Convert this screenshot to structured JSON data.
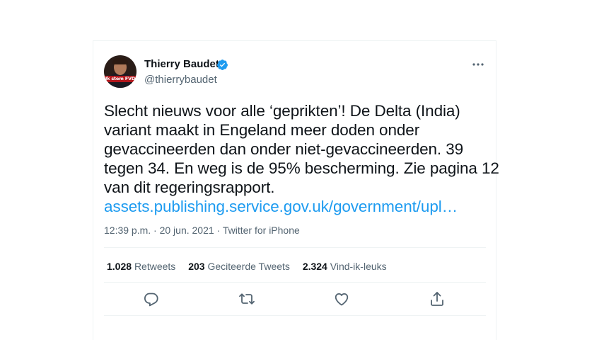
{
  "author": {
    "name": "Thierry Baudet",
    "handle": "@thierrybaudet",
    "avatar_banner": "Ik stem FVD"
  },
  "tweet": {
    "lines": [
      "Slecht nieuws voor alle ‘geprikten’! De Delta (India)",
      "variant maakt in Engeland meer doden onder",
      "gevaccineerden dan onder niet-gevaccineerden. 39",
      "tegen 34. En weg is de 95% bescherming. Zie pagina 12",
      "van dit regeringsrapport."
    ],
    "link": "assets.publishing.service.gov.uk/government/upl…"
  },
  "meta": "12:39 p.m. · 20 jun. 2021 · Twitter for iPhone",
  "stats": {
    "retweets_count": "1.028",
    "retweets_label": "Retweets",
    "quotes_count": "203",
    "quotes_label": "Geciteerde Tweets",
    "likes_count": "2.324",
    "likes_label": "Vind-ik-leuks"
  },
  "colors": {
    "link": "#1d9bf0",
    "verified": "#1d9bf0",
    "secondary_text": "#536471"
  },
  "icons": {
    "reply": "reply-icon",
    "retweet": "retweet-icon",
    "like": "heart-icon",
    "share": "share-icon",
    "more": "more-icon",
    "verified": "verified-badge-icon"
  }
}
